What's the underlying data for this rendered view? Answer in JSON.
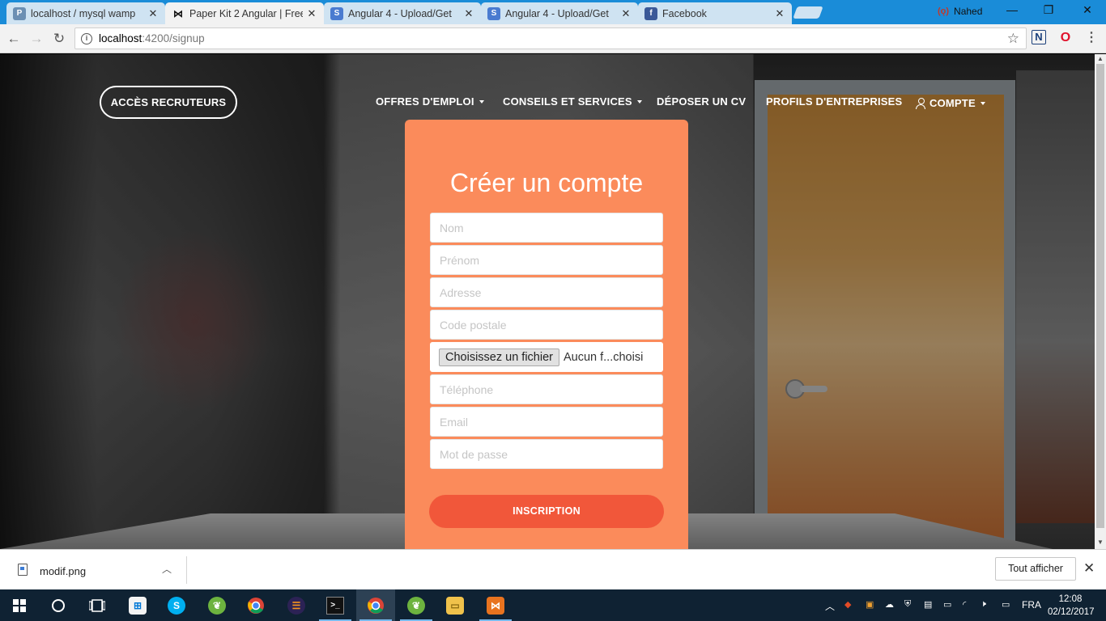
{
  "browser": {
    "tabs": [
      {
        "title": "localhost / mysql wamp",
        "icon": "phpmyadmin-icon",
        "active": false
      },
      {
        "title": "Paper Kit 2 Angular | Free",
        "icon": "bowtie-icon",
        "active": true
      },
      {
        "title": "Angular 4 - Upload/Get",
        "icon": "stackoverflow-icon",
        "active": false
      },
      {
        "title": "Angular 4 - Upload/Get",
        "icon": "stackoverflow-icon",
        "active": false
      },
      {
        "title": "Facebook",
        "icon": "facebook-icon",
        "active": false
      }
    ],
    "profile_name": "Nahed",
    "url_host": "localhost",
    "url_rest": ":4200/signup"
  },
  "site_nav": {
    "recruiter_button": "ACCÈS RECRUTEURS",
    "items": [
      {
        "label": "OFFRES D'EMPLOI",
        "dropdown": true
      },
      {
        "label": "CONSEILS ET SERVICES",
        "dropdown": true
      },
      {
        "label": "DÉPOSER UN CV",
        "dropdown": false
      },
      {
        "label": "PROFILS D'ENTREPRISES",
        "dropdown": false
      },
      {
        "label": "COMPTE",
        "dropdown": true,
        "icon": "user-icon"
      }
    ]
  },
  "signup_form": {
    "title": "Créer un compte",
    "fields": {
      "nom": {
        "placeholder": "Nom",
        "value": ""
      },
      "prenom": {
        "placeholder": "Prénom",
        "value": ""
      },
      "adresse": {
        "placeholder": "Adresse",
        "value": ""
      },
      "code_postal": {
        "placeholder": "Code postale",
        "value": ""
      },
      "telephone": {
        "placeholder": "Téléphone",
        "value": ""
      },
      "email": {
        "placeholder": "Email",
        "value": ""
      },
      "mot_de_passe": {
        "placeholder": "Mot de passe",
        "value": ""
      }
    },
    "file_button": "Choisissez un fichier",
    "file_status": "Aucun f...choisi",
    "submit_label": "INSCRIPTION",
    "card_color": "#fb8b5b",
    "button_color": "#f1573a"
  },
  "download_bar": {
    "file_name": "modif.png",
    "show_all": "Tout afficher"
  },
  "taskbar": {
    "apps": [
      "windows-start-icon",
      "cortana-icon",
      "task-view-icon",
      "store-icon",
      "skype-icon",
      "spring-tool-icon",
      "chrome-icon",
      "eclipse-icon",
      "terminal-icon",
      "chrome-active-icon",
      "spring-icon",
      "file-explorer-icon",
      "visual-studio-icon"
    ],
    "language": "FRA",
    "time": "12:08",
    "date": "02/12/2017"
  }
}
